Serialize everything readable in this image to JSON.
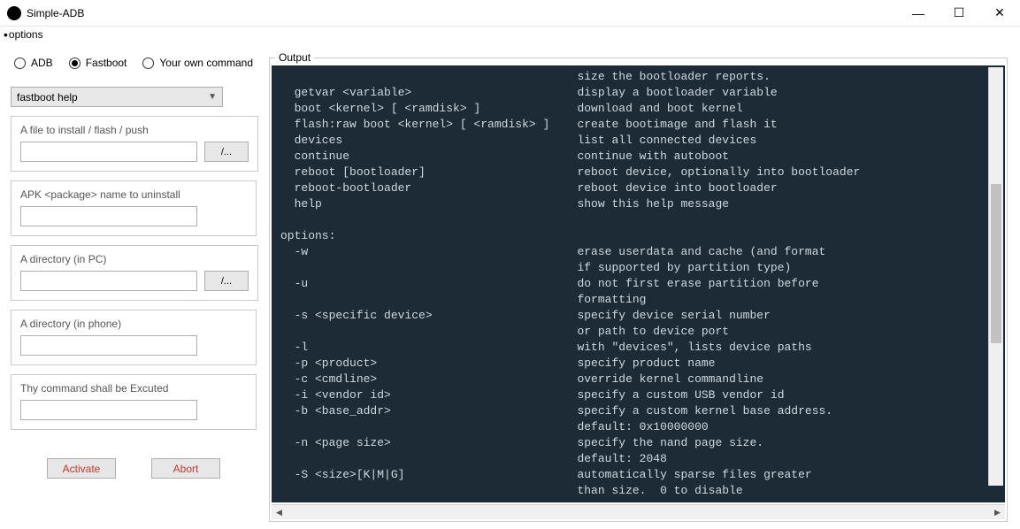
{
  "window": {
    "title": "Simple-ADB"
  },
  "menubar": {
    "options": "options"
  },
  "mode": {
    "adb": "ADB",
    "fastboot": "Fastboot",
    "own": "Your own command",
    "selected": "fastboot"
  },
  "combo": {
    "value": "fastboot help"
  },
  "fields": {
    "file_label": "A file to install / flash / push",
    "file_value": "",
    "apk_label": "APK <package> name to uninstall",
    "apk_value": "",
    "dir_pc_label": "A directory (in PC)",
    "dir_pc_value": "",
    "dir_phone_label": "A directory (in phone)",
    "dir_phone_value": "",
    "cmd_label": "Thy command shall be Excuted",
    "cmd_value": "",
    "browse": "/..."
  },
  "buttons": {
    "activate": "Activate",
    "abort": "Abort"
  },
  "output": {
    "legend": "Output",
    "text": "                                           size the bootloader reports.\n  getvar <variable>                        display a bootloader variable\n  boot <kernel> [ <ramdisk> ]              download and boot kernel\n  flash:raw boot <kernel> [ <ramdisk> ]    create bootimage and flash it\n  devices                                  list all connected devices\n  continue                                 continue with autoboot\n  reboot [bootloader]                      reboot device, optionally into bootloader\n  reboot-bootloader                        reboot device into bootloader\n  help                                     show this help message\n\noptions:\n  -w                                       erase userdata and cache (and format\n                                           if supported by partition type)\n  -u                                       do not first erase partition before\n                                           formatting\n  -s <specific device>                     specify device serial number\n                                           or path to device port\n  -l                                       with \"devices\", lists device paths\n  -p <product>                             specify product name\n  -c <cmdline>                             override kernel commandline\n  -i <vendor id>                           specify a custom USB vendor id\n  -b <base_addr>                           specify a custom kernel base address.\n                                           default: 0x10000000\n  -n <page size>                           specify the nand page size.\n                                           default: 2048\n  -S <size>[K|M|G]                         automatically sparse files greater\n                                           than size.  0 to disable"
  }
}
